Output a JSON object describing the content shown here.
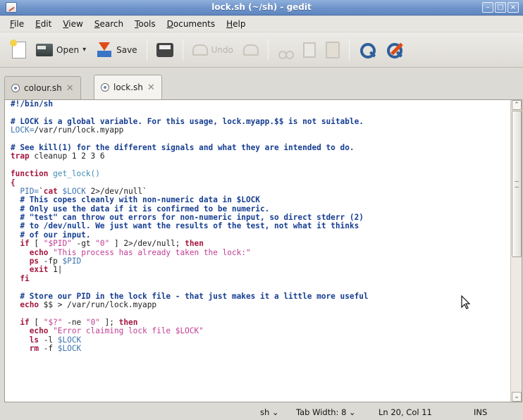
{
  "window": {
    "title": "lock.sh (~/sh) - gedit",
    "buttons": [
      "minimize",
      "maximize",
      "close"
    ]
  },
  "menu": [
    {
      "label": "File",
      "mnemonic": "F",
      "rest": "ile"
    },
    {
      "label": "Edit",
      "mnemonic": "E",
      "rest": "dit"
    },
    {
      "label": "View",
      "mnemonic": "V",
      "rest": "iew"
    },
    {
      "label": "Search",
      "mnemonic": "S",
      "rest": "earch"
    },
    {
      "label": "Tools",
      "mnemonic": "T",
      "rest": "ools"
    },
    {
      "label": "Documents",
      "mnemonic": "D",
      "rest": "ocuments"
    },
    {
      "label": "Help",
      "mnemonic": "H",
      "rest": "elp"
    }
  ],
  "toolbar": {
    "open_label": "Open",
    "save_label": "Save",
    "undo_label": "Undo"
  },
  "tabs": [
    {
      "label": "colour.sh",
      "active": false
    },
    {
      "label": "lock.sh",
      "active": true
    }
  ],
  "code_lines": [
    [
      {
        "t": "#!/bin/sh",
        "c": "c"
      }
    ],
    [
      {
        "t": "",
        "c": "t"
      }
    ],
    [
      {
        "t": "# LOCK is a global variable. For this usage, lock.myapp.$$ is not suitable.",
        "c": "c"
      }
    ],
    [
      {
        "t": "LOCK=",
        "c": "v"
      },
      {
        "t": "/var/run/lock.myapp",
        "c": "t"
      }
    ],
    [
      {
        "t": "",
        "c": "t"
      }
    ],
    [
      {
        "t": "# See kill(1) for the different signals and what they are intended to do.",
        "c": "c"
      }
    ],
    [
      {
        "t": "trap",
        "c": "k"
      },
      {
        "t": " cleanup 1 2 3 6",
        "c": "t"
      }
    ],
    [
      {
        "t": "",
        "c": "t"
      }
    ],
    [
      {
        "t": "function",
        "c": "k"
      },
      {
        "t": " get_lock()",
        "c": "f"
      }
    ],
    [
      {
        "t": "{",
        "c": "k"
      }
    ],
    [
      {
        "t": "  PID=",
        "c": "v"
      },
      {
        "t": "`",
        "c": "t"
      },
      {
        "t": "cat",
        "c": "k"
      },
      {
        "t": " ",
        "c": "t"
      },
      {
        "t": "$LOCK",
        "c": "v"
      },
      {
        "t": " 2>/dev/null`",
        "c": "t"
      }
    ],
    [
      {
        "t": "  # This copes cleanly with non-numeric data in $LOCK",
        "c": "c"
      }
    ],
    [
      {
        "t": "  # Only use the data if it is confirmed to be numeric.",
        "c": "c"
      }
    ],
    [
      {
        "t": "  # \"test\" can throw out errors for non-numeric input, so direct stderr (2)",
        "c": "c"
      }
    ],
    [
      {
        "t": "  # to /dev/null. We just want the results of the test, not what it thinks",
        "c": "c"
      }
    ],
    [
      {
        "t": "  # of our input.",
        "c": "c"
      }
    ],
    [
      {
        "t": "  ",
        "c": "t"
      },
      {
        "t": "if",
        "c": "k"
      },
      {
        "t": " [ ",
        "c": "t"
      },
      {
        "t": "\"$PID\"",
        "c": "s"
      },
      {
        "t": " -gt ",
        "c": "t"
      },
      {
        "t": "\"0\"",
        "c": "s"
      },
      {
        "t": " ] 2>/dev/null; ",
        "c": "t"
      },
      {
        "t": "then",
        "c": "k"
      }
    ],
    [
      {
        "t": "    ",
        "c": "t"
      },
      {
        "t": "echo",
        "c": "k"
      },
      {
        "t": " ",
        "c": "t"
      },
      {
        "t": "\"This process has already taken the lock:\"",
        "c": "s"
      }
    ],
    [
      {
        "t": "    ",
        "c": "t"
      },
      {
        "t": "ps",
        "c": "k"
      },
      {
        "t": " -fp ",
        "c": "t"
      },
      {
        "t": "$PID",
        "c": "v"
      }
    ],
    [
      {
        "t": "    ",
        "c": "t"
      },
      {
        "t": "exit",
        "c": "k"
      },
      {
        "t": " 1|",
        "c": "t"
      }
    ],
    [
      {
        "t": "  ",
        "c": "t"
      },
      {
        "t": "fi",
        "c": "k"
      }
    ],
    [
      {
        "t": "",
        "c": "t"
      }
    ],
    [
      {
        "t": "  # Store our PID in the lock file - that just makes it a little more useful",
        "c": "c"
      }
    ],
    [
      {
        "t": "  ",
        "c": "t"
      },
      {
        "t": "echo",
        "c": "k"
      },
      {
        "t": " $$ > /var/run/lock.myapp",
        "c": "t"
      }
    ],
    [
      {
        "t": "",
        "c": "t"
      }
    ],
    [
      {
        "t": "  ",
        "c": "t"
      },
      {
        "t": "if",
        "c": "k"
      },
      {
        "t": " [ ",
        "c": "t"
      },
      {
        "t": "\"$?\"",
        "c": "s"
      },
      {
        "t": " -ne ",
        "c": "t"
      },
      {
        "t": "\"0\"",
        "c": "s"
      },
      {
        "t": " ]; ",
        "c": "t"
      },
      {
        "t": "then",
        "c": "k"
      }
    ],
    [
      {
        "t": "    ",
        "c": "t"
      },
      {
        "t": "echo",
        "c": "k"
      },
      {
        "t": " ",
        "c": "t"
      },
      {
        "t": "\"Error claiming lock file $LOCK\"",
        "c": "s"
      }
    ],
    [
      {
        "t": "    ",
        "c": "t"
      },
      {
        "t": "ls",
        "c": "k"
      },
      {
        "t": " -l ",
        "c": "t"
      },
      {
        "t": "$LOCK",
        "c": "v"
      }
    ],
    [
      {
        "t": "    ",
        "c": "t"
      },
      {
        "t": "rm",
        "c": "k"
      },
      {
        "t": " -f ",
        "c": "t"
      },
      {
        "t": "$LOCK",
        "c": "v"
      }
    ]
  ],
  "status": {
    "language": "sh ⌄",
    "tab_width": "Tab Width:  8 ⌄",
    "position": "Ln 20, Col 11",
    "mode": "INS"
  },
  "icons": {
    "new": "new-document-icon",
    "open": "folder-icon",
    "save": "save-icon",
    "print": "print-icon",
    "undo": "undo-icon",
    "redo": "redo-icon",
    "cut": "cut-icon",
    "copy": "copy-icon",
    "paste": "paste-icon",
    "find": "find-icon",
    "replace": "find-replace-icon"
  },
  "colors": {
    "comment": "#163e92",
    "keyword": "#a3173f",
    "string": "#c23d94",
    "variable": "#3d75b0"
  }
}
